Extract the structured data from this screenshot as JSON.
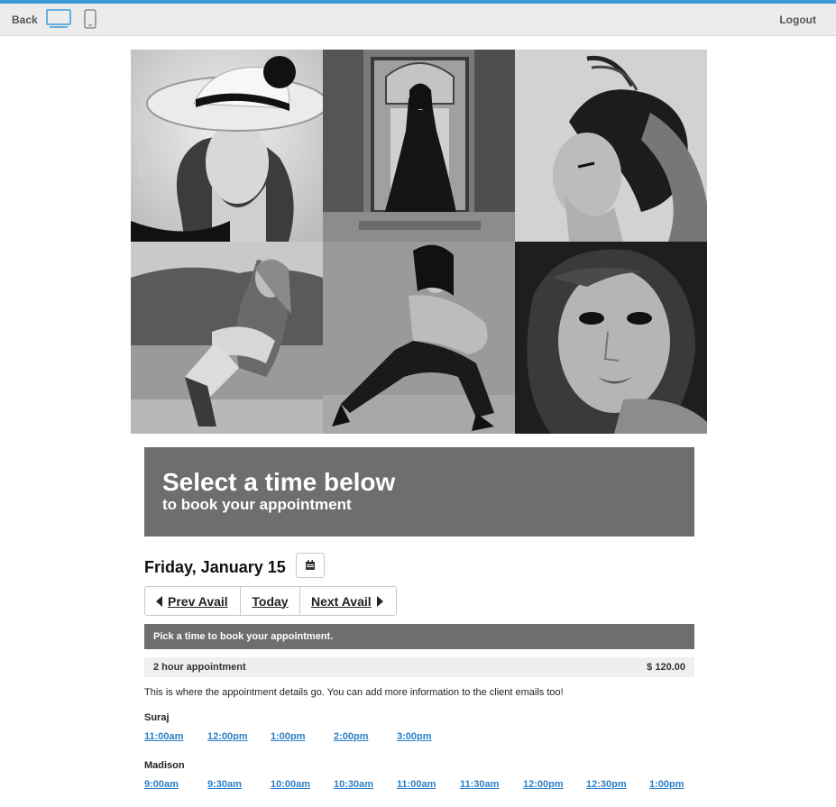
{
  "topbar": {
    "back_label": "Back",
    "logout_label": "Logout",
    "accent_color": "#3a9ad9",
    "icons": [
      "desktop-icon",
      "mobile-icon"
    ]
  },
  "gallery": {
    "photos": [
      "woman-in-hat",
      "woman-in-gown-doorway",
      "woman-hair-profile",
      "woman-sitting-lakeside",
      "woman-crouching",
      "woman-closeup-portrait"
    ]
  },
  "banner": {
    "title": "Select a time below",
    "subtitle": "to book your appointment"
  },
  "schedule": {
    "date": "Friday, January 15",
    "prev_label": "Prev Avail",
    "today_label": "Today",
    "next_label": "Next Avail"
  },
  "pick_message": "Pick a time to book your appointment.",
  "appointment": {
    "name": "2 hour appointment",
    "price": "$ 120.00",
    "details": "This is where the appointment details go. You can add more information to the client emails too!"
  },
  "staff": [
    {
      "name": "Suraj",
      "times": [
        "11:00am",
        "12:00pm",
        "1:00pm",
        "2:00pm",
        "3:00pm"
      ]
    },
    {
      "name": "Madison",
      "times": [
        "9:00am",
        "9:30am",
        "10:00am",
        "10:30am",
        "11:00am",
        "11:30am",
        "12:00pm",
        "12:30pm",
        "1:00pm"
      ]
    }
  ],
  "colors": {
    "banner": "#6e6e6e",
    "link": "#2a80c8"
  }
}
